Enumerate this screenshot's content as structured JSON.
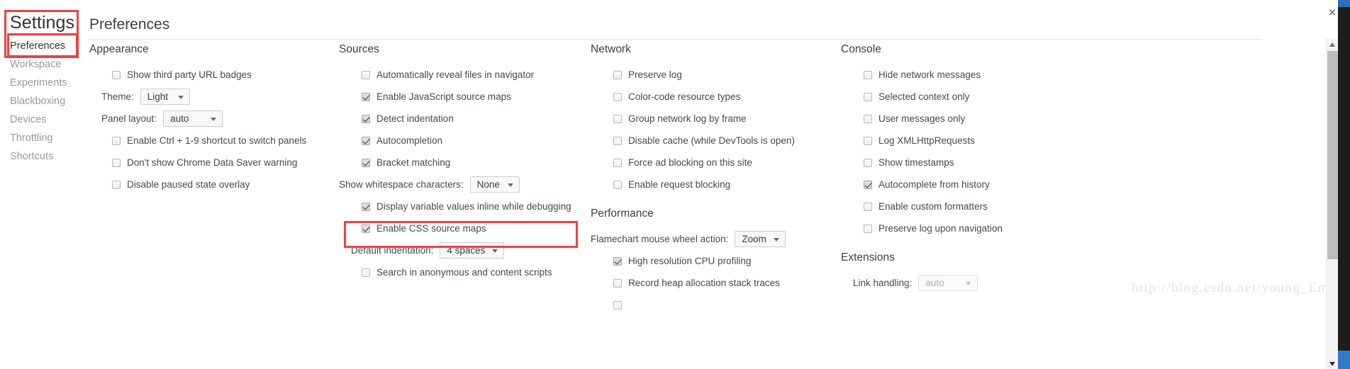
{
  "window": {
    "close_label": "×"
  },
  "sidebar": {
    "title": "Settings",
    "items": [
      {
        "label": "Preferences",
        "selected": true
      },
      {
        "label": "Workspace",
        "selected": false
      },
      {
        "label": "Experiments",
        "selected": false
      },
      {
        "label": "Blackboxing",
        "selected": false
      },
      {
        "label": "Devices",
        "selected": false
      },
      {
        "label": "Throttling",
        "selected": false
      },
      {
        "label": "Shortcuts",
        "selected": false
      }
    ]
  },
  "main": {
    "page_title": "Preferences"
  },
  "appearance": {
    "title": "Appearance",
    "show_third_party_url_badges": "Show third party URL badges",
    "theme_label": "Theme:",
    "theme_value": "Light",
    "panel_layout_label": "Panel layout:",
    "panel_layout_value": "auto",
    "enable_ctrl_shortcut": "Enable Ctrl + 1-9 shortcut to switch panels",
    "dont_show_data_saver": "Don't show Chrome Data Saver warning",
    "disable_paused_overlay": "Disable paused state overlay"
  },
  "sources": {
    "title": "Sources",
    "auto_reveal": "Automatically reveal files in navigator",
    "js_source_maps": "Enable JavaScript source maps",
    "detect_indentation": "Detect indentation",
    "autocompletion": "Autocompletion",
    "bracket_matching": "Bracket matching",
    "whitespace_label": "Show whitespace characters:",
    "whitespace_value": "None",
    "display_inline_values": "Display variable values inline while debugging",
    "css_source_maps": "Enable CSS source maps",
    "default_indentation_label": "Default indentation:",
    "default_indentation_value": "4 spaces",
    "search_anonymous": "Search in anonymous and content scripts"
  },
  "network": {
    "title": "Network",
    "preserve_log": "Preserve log",
    "color_code": "Color-code resource types",
    "group_by_frame": "Group network log by frame",
    "disable_cache": "Disable cache (while DevTools is open)",
    "force_ad_blocking": "Force ad blocking on this site",
    "enable_request_blocking": "Enable request blocking"
  },
  "performance": {
    "title": "Performance",
    "flamechart_label": "Flamechart mouse wheel action:",
    "flamechart_value": "Zoom",
    "high_res_cpu": "High resolution CPU profiling",
    "record_heap": "Record heap allocation stack traces"
  },
  "console": {
    "title": "Console",
    "hide_network_messages": "Hide network messages",
    "selected_context_only": "Selected context only",
    "user_messages_only": "User messages only",
    "log_xhr": "Log XMLHttpRequests",
    "show_timestamps": "Show timestamps",
    "autocomplete_history": "Autocomplete from history",
    "custom_formatters": "Enable custom formatters",
    "preserve_log_nav": "Preserve log upon navigation"
  },
  "extensions": {
    "title": "Extensions",
    "link_handling_label": "Link handling:",
    "link_handling_value": "auto"
  },
  "watermark": {
    "text": "http://blog.csdn.net/young_Emily"
  },
  "colors": {
    "annotation": "#f0413f",
    "text": "#444a4f",
    "muted": "#9a9a9a"
  }
}
